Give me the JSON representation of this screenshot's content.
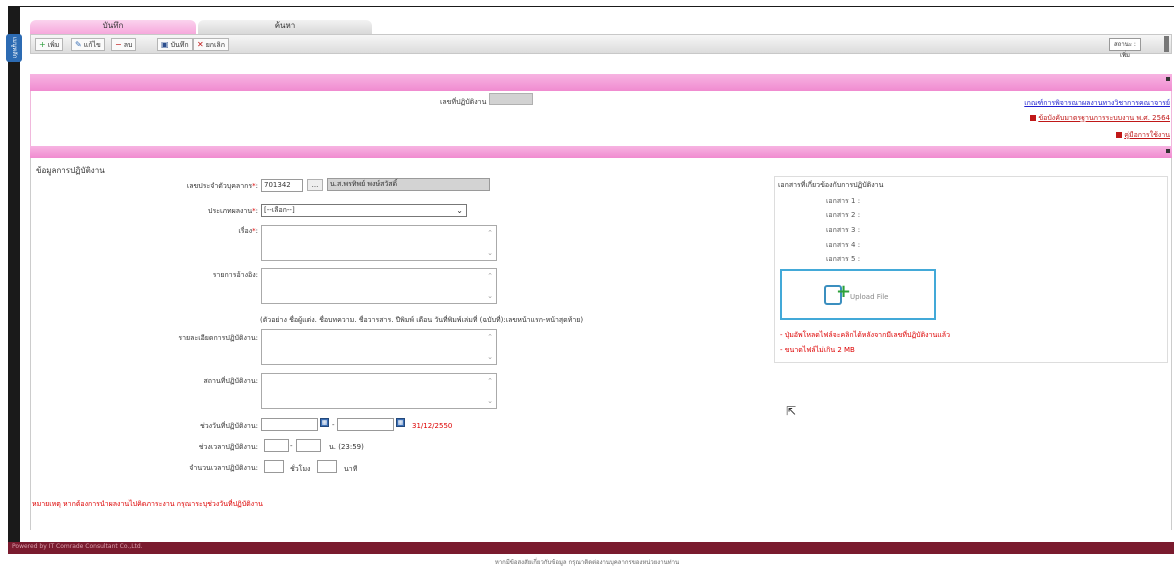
{
  "tabs": {
    "record": "บันทึก",
    "search": "ค้นหา"
  },
  "side_tab": {
    "label": "เมนูหลัก",
    "arrow": "►"
  },
  "toolbar": {
    "add": "เพิ่ม",
    "edit": "แก้ไข",
    "delete": "ลบ",
    "save": "บันทึก",
    "cancel": "ยกเลิก",
    "status": "สถานะ : เพิ่ม"
  },
  "header": {
    "doc_no_label": "เลขที่ปฏิบัติงาน :",
    "doc_no_value": "",
    "link_criteria": "เกณฑ์การพิจารณาผลงานทางวิชาการคณาจารย์",
    "link_regulation": "ข้อบังคับมาตรฐานการระบบงาน พ.ศ. 2564",
    "link_manual": "คู่มือการใช้งาน"
  },
  "section": {
    "title": "ข้อมูลการปฏิบัติงาน"
  },
  "form": {
    "staff_id_label": "เลขประจำตัวบุคลากร",
    "staff_id_value": "701342",
    "lookup_button": "...",
    "staff_name": "น.ส.พรทิพย์ พงษ์สวัสดิ์",
    "work_type_label": "ประเภทผลงาน",
    "work_type_value": "[--เลือก--]",
    "subject_label": "เรื่อง",
    "reference_label": "รายการอ้างอิง",
    "reference_hint": "(ตัวอย่าง ชื่อผู้แต่ง. ชื่อบทความ. ชื่อวารสาร. ปีพิมพ์ เดือน วันที่พิมพ์เล่มที่ (ฉบับที่):เลขหน้าแรก-หน้าสุดท้าย)",
    "detail_label": "รายละเอียดการปฏิบัติงาน",
    "place_label": "สถานที่ปฏิบัติงาน",
    "date_range_label": "ช่วงวันที่ปฏิบัติงาน",
    "date_separator": "-",
    "date_example": "31/12/2550",
    "time_range_label": "ช่วงเวลาปฏิบัติงาน",
    "time_separator": "-",
    "time_unit": "น.  (23:59)",
    "duration_label": "จำนวนเวลาปฏิบัติงาน",
    "hours_unit": "ชั่วโมง",
    "minutes_unit": "นาที",
    "required_mark": "*",
    "colon": ":"
  },
  "documents": {
    "title": "เอกสารที่เกี่ยวข้องกับการปฏิบัติงาน",
    "items": [
      "เอกสาร 1 :",
      "เอกสาร 2 :",
      "เอกสาร 3 :",
      "เอกสาร 4 :",
      "เอกสาร 5 :"
    ],
    "upload_label": "Upload File",
    "note1": "- ปุ่มอัพโหลดไฟล์จะคลิกได้หลังจากมีเลขที่ปฏิบัติงานแล้ว",
    "note2": "- ขนาดไฟล์ไม่เกิน 2 MB"
  },
  "bottom_note": "หมายเหตุ หากต้องการนำผลงานไปคิดภาระงาน กรุณาระบุช่วงวันที่ปฏิบัติงาน",
  "footer": {
    "powered": "Powered by IT Comrade Consultant Co.,Ltd.",
    "contact": "หากมีข้อสงสัยเกี่ยวกับข้อมูล กรุณาติดต่องานบุคลากรของหน่วยงานท่าน"
  },
  "colors": {
    "pink": "#f49ad8",
    "footer": "#7a1b2e",
    "link": "#1f1fd0",
    "red": "#d00000",
    "upload_border": "#43a9d8"
  }
}
